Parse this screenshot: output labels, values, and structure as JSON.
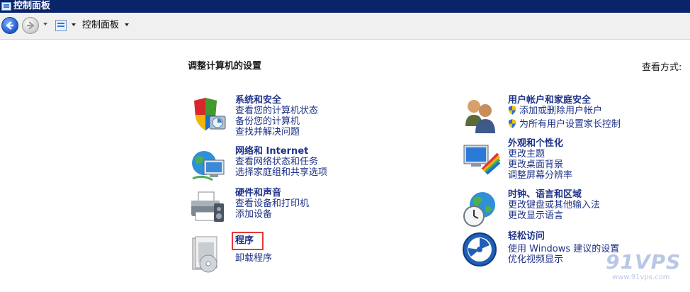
{
  "window": {
    "title": "控制面板"
  },
  "nav": {
    "breadcrumb": "控制面板"
  },
  "main": {
    "heading": "调整计算机的设置",
    "view_by_label": "查看方式:"
  },
  "categories_left": [
    {
      "title": "系统和安全",
      "icon": "security-shield-icon",
      "links": [
        "查看您的计算机状态",
        "备份您的计算机",
        "查找并解决问题"
      ]
    },
    {
      "title": "网络和 Internet",
      "icon": "network-globe-icon",
      "links": [
        "查看网络状态和任务",
        "选择家庭组和共享选项"
      ]
    },
    {
      "title": "硬件和声音",
      "icon": "printer-icon",
      "links": [
        "查看设备和打印机",
        "添加设备"
      ]
    },
    {
      "title": "程序",
      "icon": "programs-icon",
      "links": [
        "卸载程序"
      ]
    }
  ],
  "categories_right": [
    {
      "title": "用户帐户和家庭安全",
      "icon": "users-icon",
      "links": [
        "添加或删除用户帐户",
        "为所有用户设置家长控制"
      ]
    },
    {
      "title": "外观和个性化",
      "icon": "appearance-monitor-icon",
      "links": [
        "更改主题",
        "更改桌面背景",
        "调整屏幕分辨率"
      ]
    },
    {
      "title": "时钟、语言和区域",
      "icon": "clock-globe-icon",
      "links": [
        "更改键盘或其他输入法",
        "更改显示语言"
      ]
    },
    {
      "title": "轻松访问",
      "icon": "ease-of-access-icon",
      "links": [
        "使用 Windows 建议的设置",
        "优化视频显示"
      ]
    }
  ],
  "watermark": {
    "brand": "91VPS",
    "url": "www.91vps.com"
  },
  "colors": {
    "title_bar": "#0a246a",
    "link": "#1e3287",
    "highlight": "#e53935"
  }
}
